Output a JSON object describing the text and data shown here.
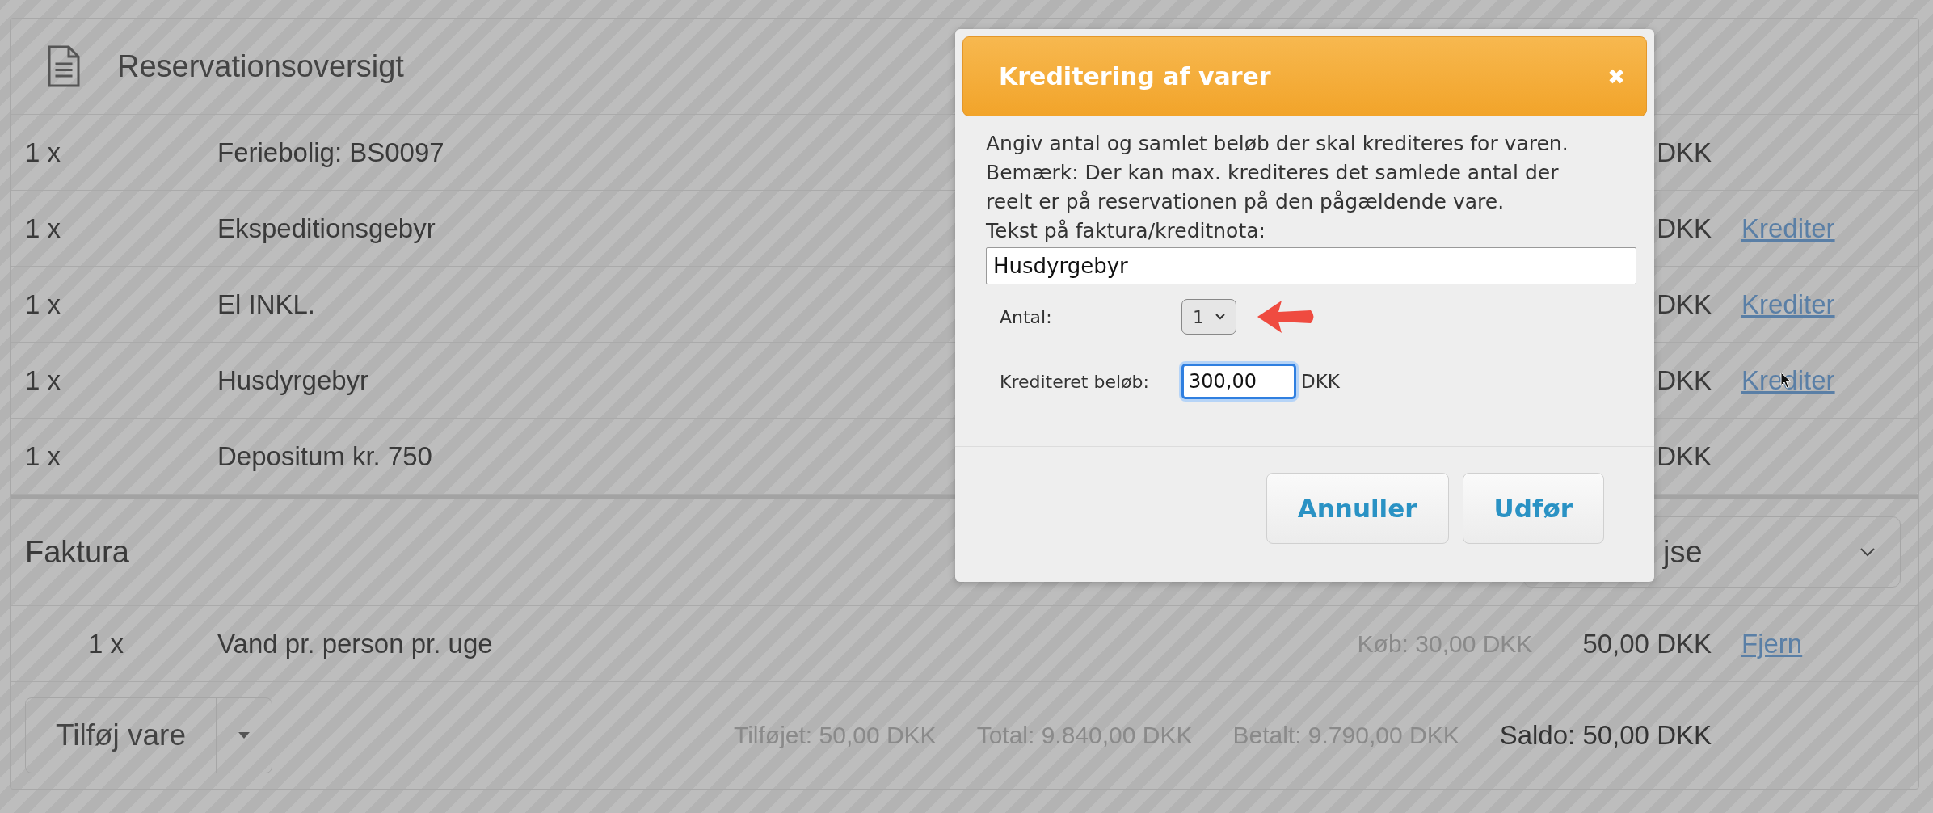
{
  "overview": {
    "title": "Reservationsoversigt",
    "rows": [
      {
        "qty": "1 x",
        "name": "Feriebolig: BS0097",
        "amount": "DKK"
      },
      {
        "qty": "1 x",
        "name": "Ekspeditionsgebyr",
        "amount": "DKK",
        "action": "Krediter"
      },
      {
        "qty": "1 x",
        "name": "El INKL.",
        "amount": "DKK",
        "action": "Krediter"
      },
      {
        "qty": "1 x",
        "name": "Husdyrgebyr",
        "amount": "DKK",
        "action": "Krediter"
      },
      {
        "qty": "1 x",
        "name": "Depositum kr. 750",
        "amount": "DKK"
      }
    ]
  },
  "invoice": {
    "title": "Faktura",
    "select": {
      "value": "jse"
    },
    "rows": [
      {
        "qty": "1 x",
        "name": "Vand pr. person pr. uge",
        "purchase": "Køb: 30,00 DKK",
        "amount": "50,00 DKK",
        "action": "Fjern"
      }
    ],
    "add_button": "Tilføj vare",
    "totals": [
      "Tilføjet: 50,00 DKK",
      "Total: 9.840,00 DKK",
      "Betalt: 9.790,00 DKK"
    ],
    "balance": "Saldo: 50,00 DKK"
  },
  "dialog": {
    "title": "Kreditering af varer",
    "close": "✖",
    "message": [
      "Angiv antal og samlet beløb der skal krediteres for varen.",
      "Bemærk: Der kan max. krediteres det samlede antal der reelt er på reservationen på den pågældende vare."
    ],
    "text_label": "Tekst på faktura/kreditnota:",
    "text_value": "Husdyrgebyr",
    "quantity_label": "Antal:",
    "quantity_value": "1",
    "amount_label": "Krediteret beløb:",
    "amount_value": "300,00",
    "currency": "DKK",
    "buttons": [
      "Annuller",
      "Udfør"
    ]
  }
}
